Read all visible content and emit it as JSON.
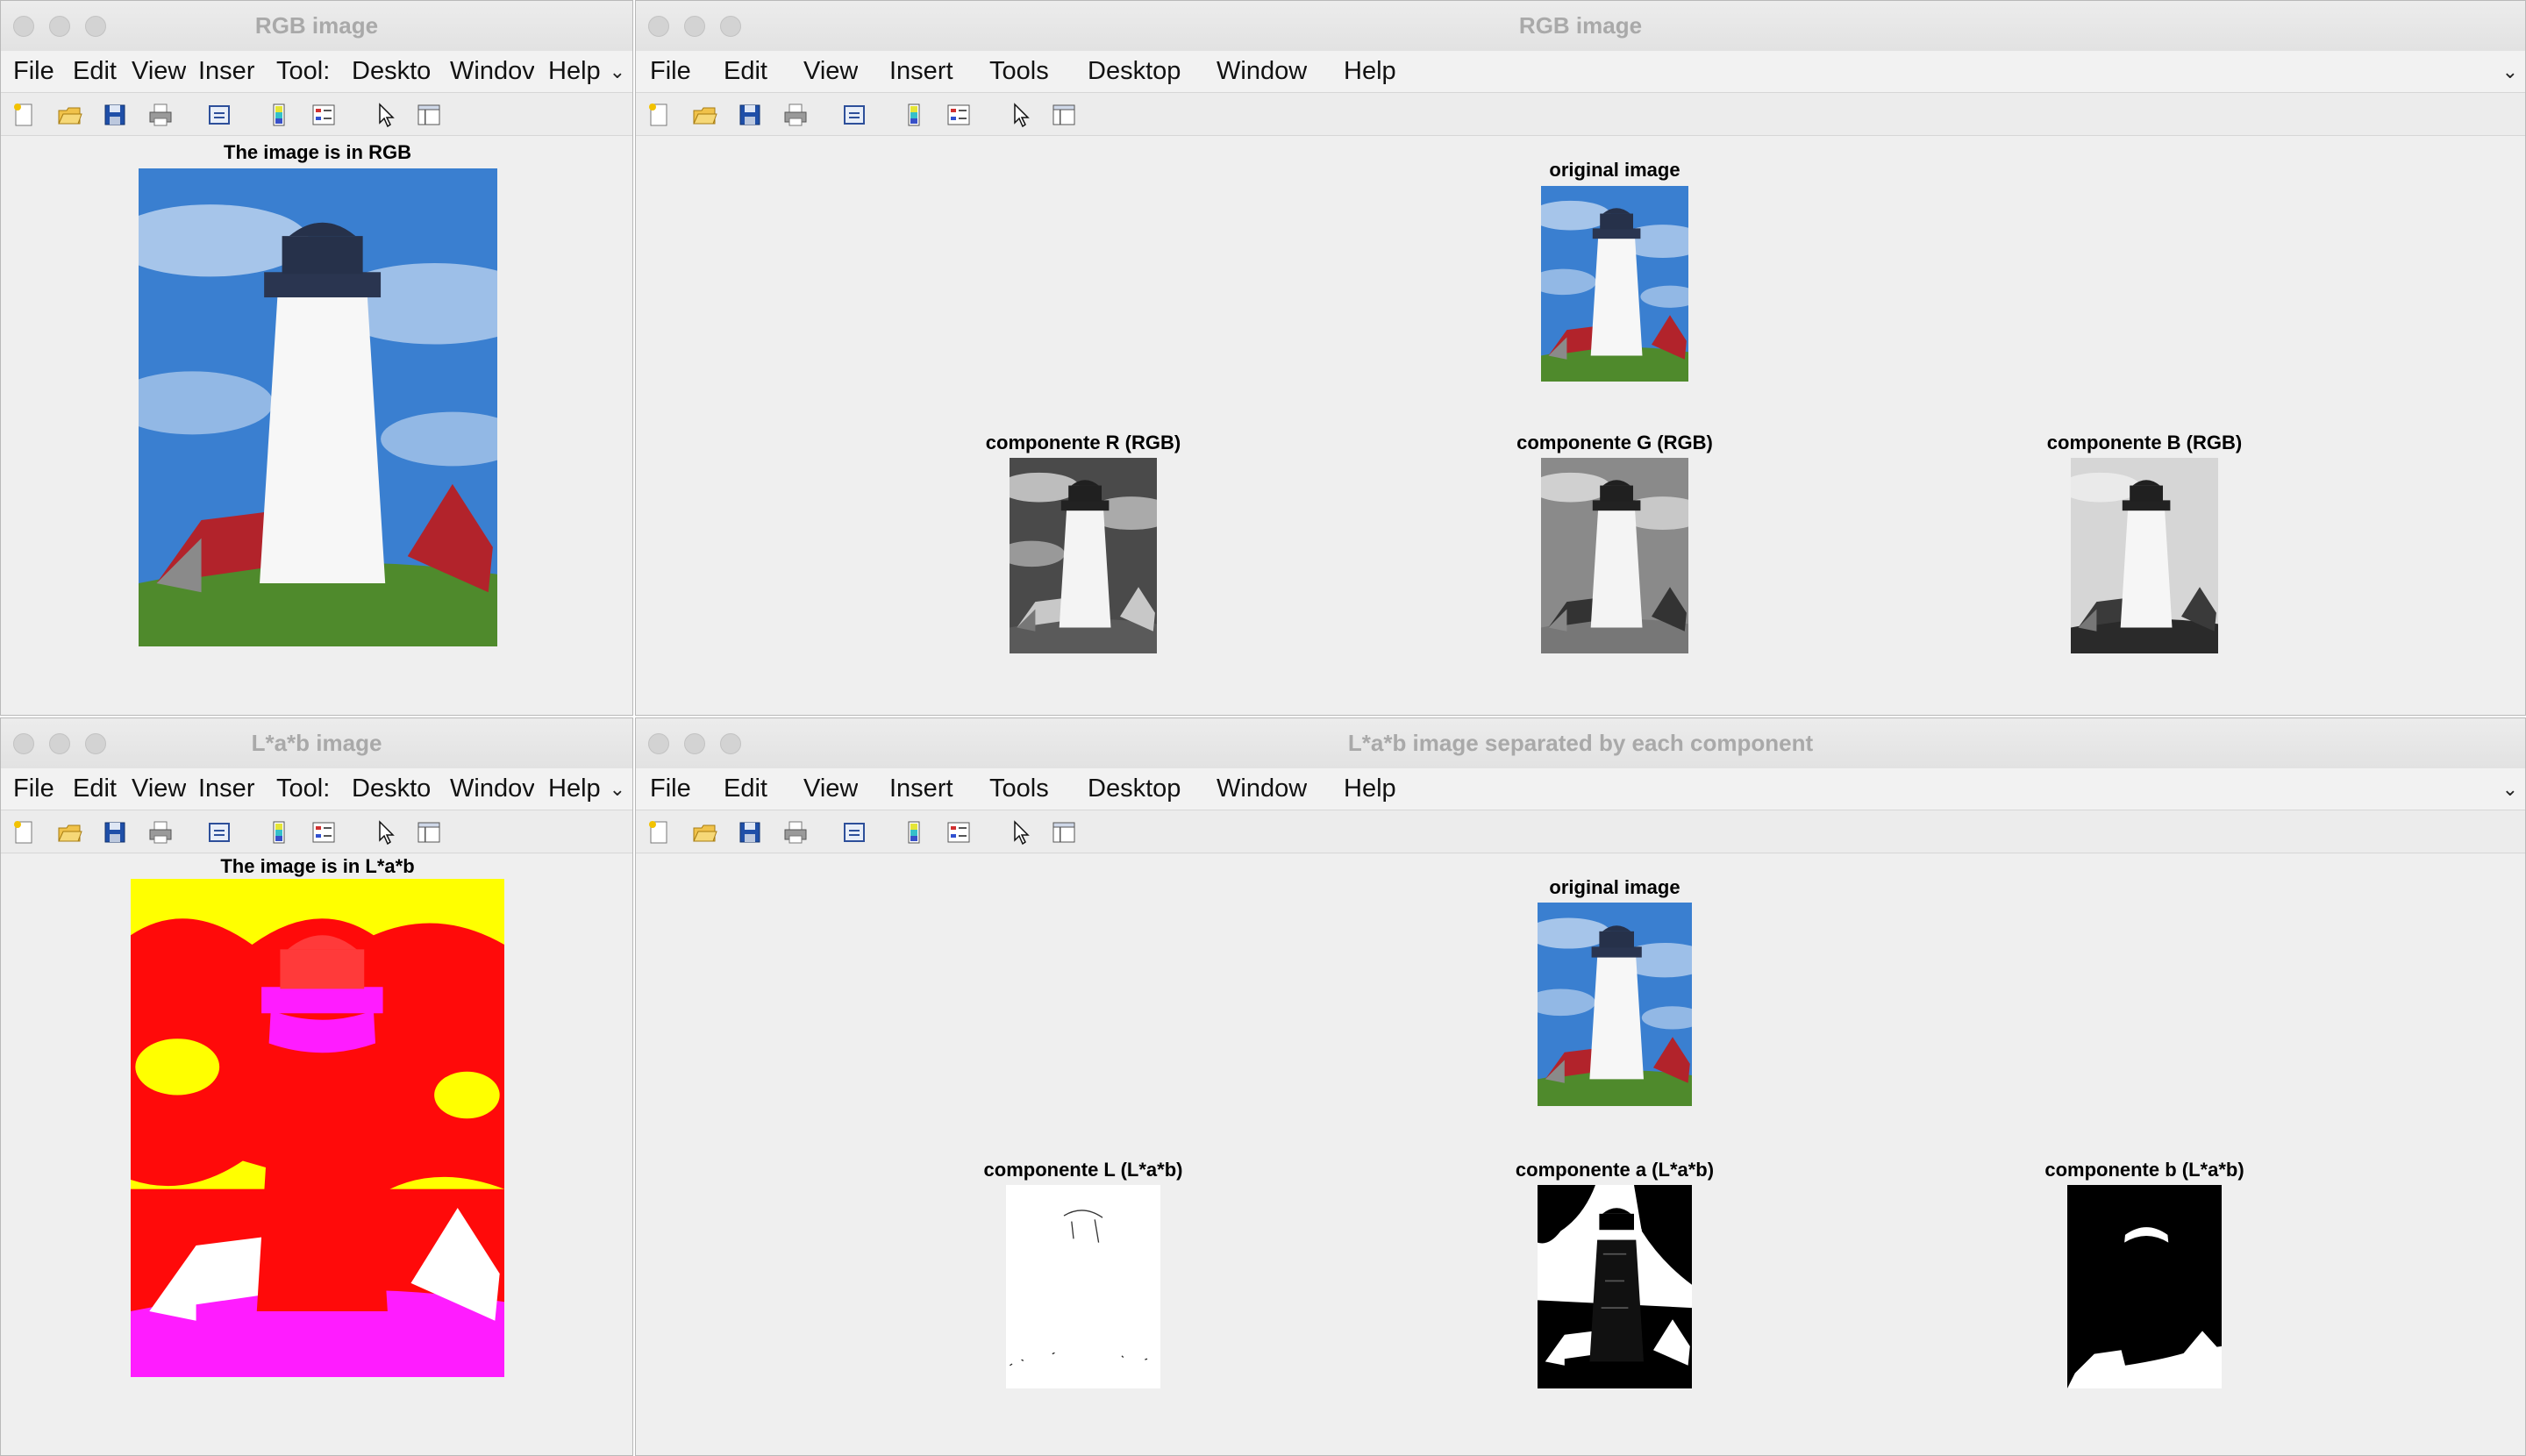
{
  "windows": {
    "rgb_small": {
      "title": "RGB image",
      "menu": [
        "File",
        "Edit",
        "View",
        "Inser",
        "Tool:",
        "Deskto",
        "Windov",
        "Help"
      ],
      "axes": [
        {
          "title": "The image is in RGB"
        }
      ]
    },
    "rgb_large": {
      "title": "RGB image",
      "menu": [
        "File",
        "Edit",
        "View",
        "Insert",
        "Tools",
        "Desktop",
        "Window",
        "Help"
      ],
      "axes": [
        {
          "title": "original image"
        },
        {
          "title": "componente R (RGB)"
        },
        {
          "title": "componente G (RGB)"
        },
        {
          "title": "componente B (RGB)"
        }
      ]
    },
    "lab_small": {
      "title": "L*a*b image",
      "menu": [
        "File",
        "Edit",
        "View",
        "Inser",
        "Tool:",
        "Deskto",
        "Windov",
        "Help"
      ],
      "axes": [
        {
          "title": "The image is in L*a*b"
        }
      ]
    },
    "lab_large": {
      "title": "L*a*b image separated by each component",
      "menu": [
        "File",
        "Edit",
        "View",
        "Insert",
        "Tools",
        "Desktop",
        "Window",
        "Help"
      ],
      "axes": [
        {
          "title": "original image"
        },
        {
          "title": "componente L (L*a*b)"
        },
        {
          "title": "componente a (L*a*b)"
        },
        {
          "title": "componente b (L*a*b)"
        }
      ]
    }
  },
  "toolbar_icons": [
    "new-figure-icon",
    "open-file-icon",
    "save-icon",
    "print-icon",
    "link-icon",
    "colorbar-icon",
    "legend-icon",
    "pointer-icon",
    "property-inspector-icon"
  ],
  "menu_overflow_symbol": "⌄",
  "colors": {
    "window_bg": "#efefef",
    "title_text": "#a9a9a9",
    "sky": "#3a7fd0",
    "grass": "#4f8a2c",
    "roof": "#b2232b",
    "lab_red": "#ff0a0a",
    "lab_yellow": "#ffff00",
    "lab_magenta": "#ff1cff"
  }
}
